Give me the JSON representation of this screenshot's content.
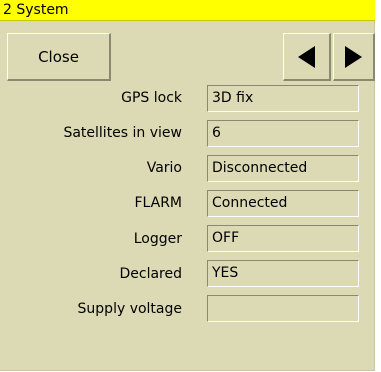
{
  "window": {
    "title": "2 System"
  },
  "toolbar": {
    "close_label": "Close",
    "prev_icon": "triangle-left",
    "next_icon": "triangle-right"
  },
  "rows": [
    {
      "label": "GPS lock",
      "value": "3D fix"
    },
    {
      "label": "Satellites in view",
      "value": "6"
    },
    {
      "label": "Vario",
      "value": "Disconnected"
    },
    {
      "label": "FLARM",
      "value": "Connected"
    },
    {
      "label": "Logger",
      "value": "OFF"
    },
    {
      "label": "Declared",
      "value": "YES"
    },
    {
      "label": "Supply voltage",
      "value": ""
    }
  ],
  "colors": {
    "titlebar": "#ffff00",
    "background": "#dcdab4"
  }
}
